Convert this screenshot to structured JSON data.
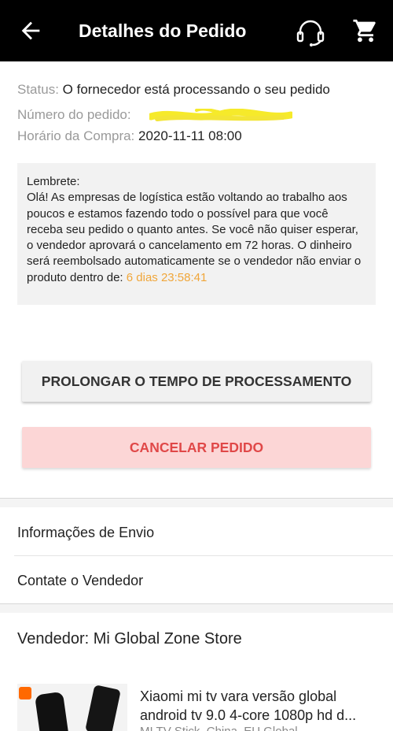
{
  "header": {
    "title": "Detalhes do Pedido",
    "back_icon": "arrow-left-icon",
    "support_icon": "headset-icon",
    "cart_icon": "cart-icon"
  },
  "order": {
    "status_label": "Status:",
    "status_value": "O fornecedor está processando o seu pedido",
    "number_label": "Número do pedido:",
    "time_label": "Horário da Compra:",
    "time_value": "2020-11-11 08:00"
  },
  "reminder": {
    "title": "Lembrete:",
    "body": "Olá! As empresas de logística estão voltando ao trabalho aos poucos e estamos fazendo todo o possível para que você receba seu pedido o quanto antes. Se você não quiser esperar, o vendedor aprovará o cancelamento em 72 horas. O dinheiro será reembolsado automaticamente se o vendedor não enviar o produto dentro de: ",
    "countdown": "6 dias 23:58:41",
    "highlight_color": "#f0a63a"
  },
  "buttons": {
    "extend": "PROLONGAR O TEMPO DE PROCESSAMENTO",
    "cancel": "CANCELAR PEDIDO"
  },
  "links": {
    "shipping": "Informações de Envio",
    "contact": "Contate o Vendedor"
  },
  "seller": {
    "label": "Vendedor: Mi Global Zone Store"
  },
  "product": {
    "title": "Xiaomi mi tv vara versão global android tv 9.0 4-core 1080p hd d...",
    "subtitle": "MI TV Stick, China, EU Global"
  }
}
